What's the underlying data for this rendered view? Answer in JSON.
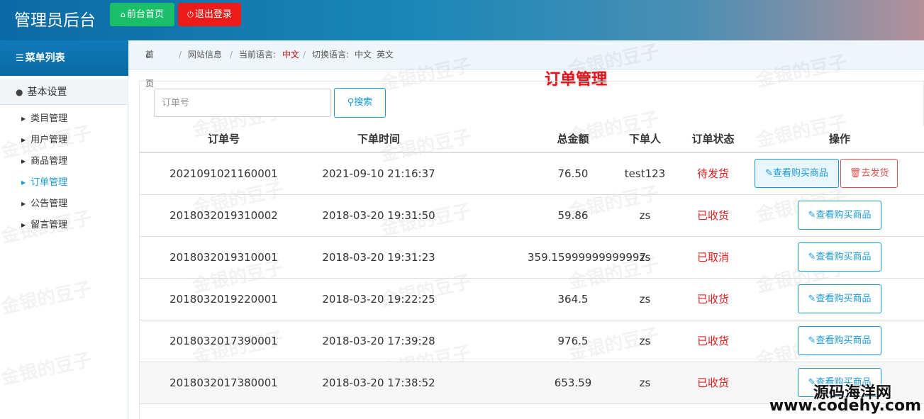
{
  "header": {
    "title": "管理员后台",
    "home_button": "前台首页",
    "logout_button": "退出登录"
  },
  "sidebar": {
    "menu_title": "菜单列表",
    "group_title": "基本设置",
    "items": [
      {
        "label": "类目管理"
      },
      {
        "label": "用户管理"
      },
      {
        "label": "商品管理"
      },
      {
        "label": "订单管理"
      },
      {
        "label": "公告管理"
      },
      {
        "label": "留言管理"
      }
    ]
  },
  "breadcrumb": {
    "home": "首页",
    "site_info": "网站信息",
    "current_lang_label": "当前语言:",
    "current_lang": "中文",
    "switch_lang_label": "切换语言:",
    "lang_options": [
      "中文",
      "英文"
    ]
  },
  "page": {
    "title": "订单管理"
  },
  "search": {
    "placeholder": "订单号",
    "button": "搜索"
  },
  "table": {
    "headers": [
      "订单号",
      "下单时间",
      "总金额",
      "下单人",
      "订单状态",
      "操作"
    ],
    "view_button": "查看购买商品",
    "ship_button": "去发货",
    "rows": [
      {
        "id": "2021091021160001",
        "time": "2021-09-10 21:16:37",
        "amount": "76.50",
        "user": "test123",
        "status": "待发货"
      },
      {
        "id": "2018032019310002",
        "time": "2018-03-20 19:31:50",
        "amount": "59.86",
        "user": "zs",
        "status": "已收货"
      },
      {
        "id": "2018032019310001",
        "time": "2018-03-20 19:31:23",
        "amount": "359.15999999999997",
        "user": "zs",
        "status": "已取消"
      },
      {
        "id": "2018032019220001",
        "time": "2018-03-20 19:22:25",
        "amount": "364.5",
        "user": "zs",
        "status": "已收货"
      },
      {
        "id": "2018032017390001",
        "time": "2018-03-20 17:39:28",
        "amount": "976.5",
        "user": "zs",
        "status": "已收货"
      },
      {
        "id": "2018032017380001",
        "time": "2018-03-20 17:38:52",
        "amount": "653.59",
        "user": "zs",
        "status": "已收货"
      }
    ]
  },
  "watermark": {
    "text": "金银的豆子"
  },
  "logo": {
    "line1": "源码海洋网",
    "line2": "www.codehy.com"
  },
  "colors": {
    "accent": "#1a9ad6",
    "danger": "#e31c1c",
    "home_btn": "#1bbf6a",
    "logout_btn": "#ee1b1b"
  }
}
